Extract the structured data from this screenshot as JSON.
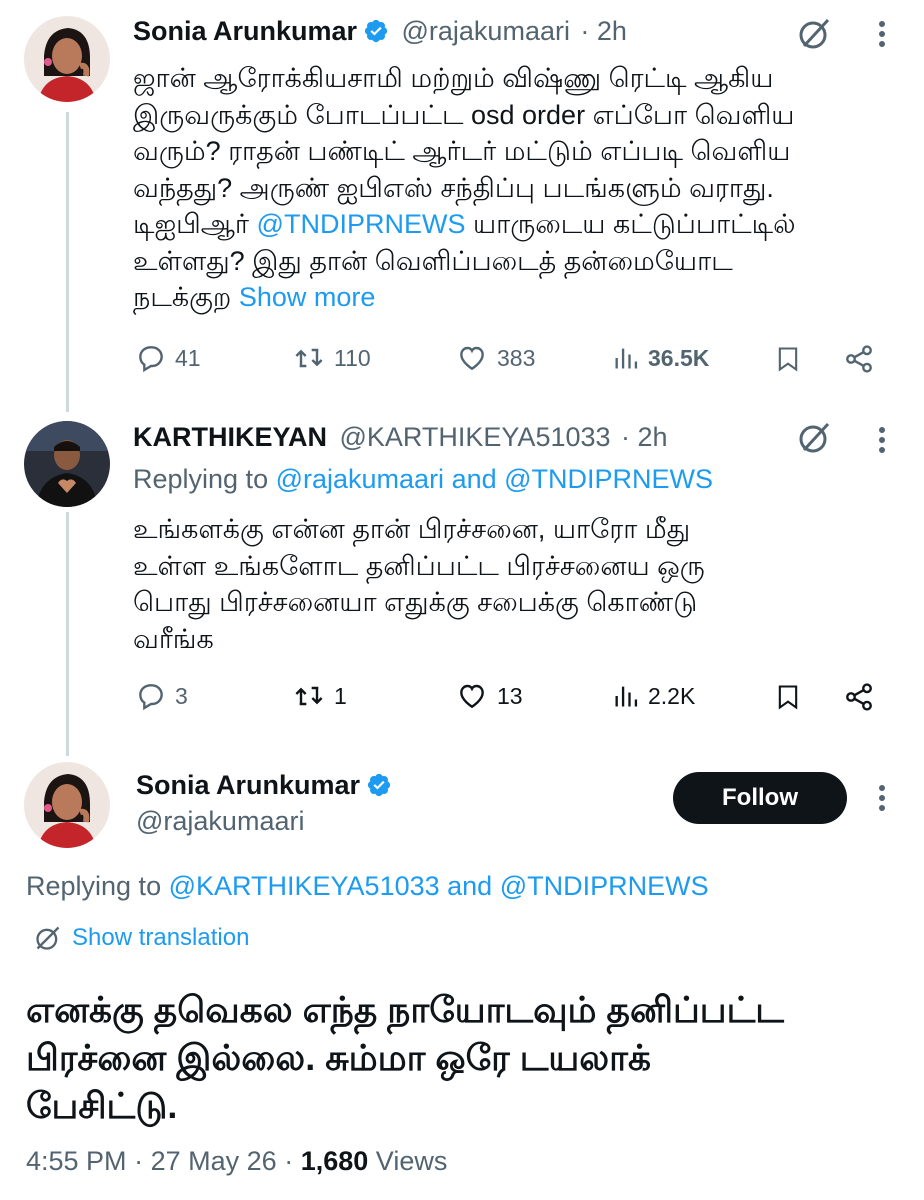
{
  "tweet1": {
    "name": "Sonia Arunkumar",
    "handle": "@rajakumaari",
    "time": "· 2h",
    "lines": [
      "ஜான் ஆரோக்கியசாமி மற்றும் விஷ்ணு ரெட்டி ஆகிய",
      "இருவருக்கும் போடப்பட்ட osd order எப்போ வெளிய",
      "வரும்? ராதன் பண்டிட் ஆர்டர் மட்டும் எப்படி வெளிய",
      "வந்தது? அருண் ஐபிஎஸ் சந்திப்பு படங்களும் வராது."
    ],
    "line5_pre": "டிஐபிஆர் ",
    "line5_mention": "@TNDIPRNEWS",
    "line5_post": " யாருடைய கட்டுப்பாட்டில்",
    "line6": "உள்ளது? இது தான் வெளிப்படைத் தன்மையோட",
    "line7": "நடக்குற ",
    "show_more": "Show more",
    "replies": "41",
    "retweets": "110",
    "likes": "383",
    "views": "36.5K"
  },
  "tweet2": {
    "name": "KARTHIKEYAN",
    "handle": "@KARTHIKEYA51033",
    "time": "· 2h",
    "replying_to": "Replying to ",
    "replying_mention1": "@rajakumaari",
    "replying_and": " and ",
    "replying_mention2": "@TNDIPRNEWS",
    "lines": [
      "உங்களக்கு என்ன தான் பிரச்சனை, யாரோ மீது",
      "உள்ள உங்களோட தனிப்பட்ட பிரச்சனைய ஒரு",
      "பொது பிரச்சனையா எதுக்கு சபைக்கு கொண்டு",
      "வரீங்க"
    ],
    "replies": "3",
    "retweets": "1",
    "likes": "13",
    "views": "2.2K"
  },
  "main_tweet": {
    "name": "Sonia Arunkumar",
    "handle": "@rajakumaari",
    "follow_label": "Follow",
    "replying_to": "Replying to ",
    "replying_mention1": "@KARTHIKEYA51033",
    "replying_and": " and ",
    "replying_mention2": "@TNDIPRNEWS",
    "show_translation": "Show translation",
    "lines": [
      "எனக்கு தவெகல எந்த நாயோடவும் தனிப்பட்ட",
      "பிரச்னை இல்லை. சும்மா ஒரே டயலாக்",
      "பேசிட்டு."
    ],
    "time": "4:55 PM",
    "date": "27 May 26",
    "views_count": "1,680",
    "views_label": "Views"
  },
  "colors": {
    "accent": "#1d9bf0",
    "text": "#0f1419",
    "secondary": "#536471",
    "thread_line": "#cfd9de"
  },
  "icons": [
    "verified-badge-icon",
    "grok-icon",
    "more-icon",
    "reply-icon",
    "retweet-icon",
    "like-icon",
    "views-icon",
    "bookmark-icon",
    "share-icon",
    "translate-icon"
  ]
}
